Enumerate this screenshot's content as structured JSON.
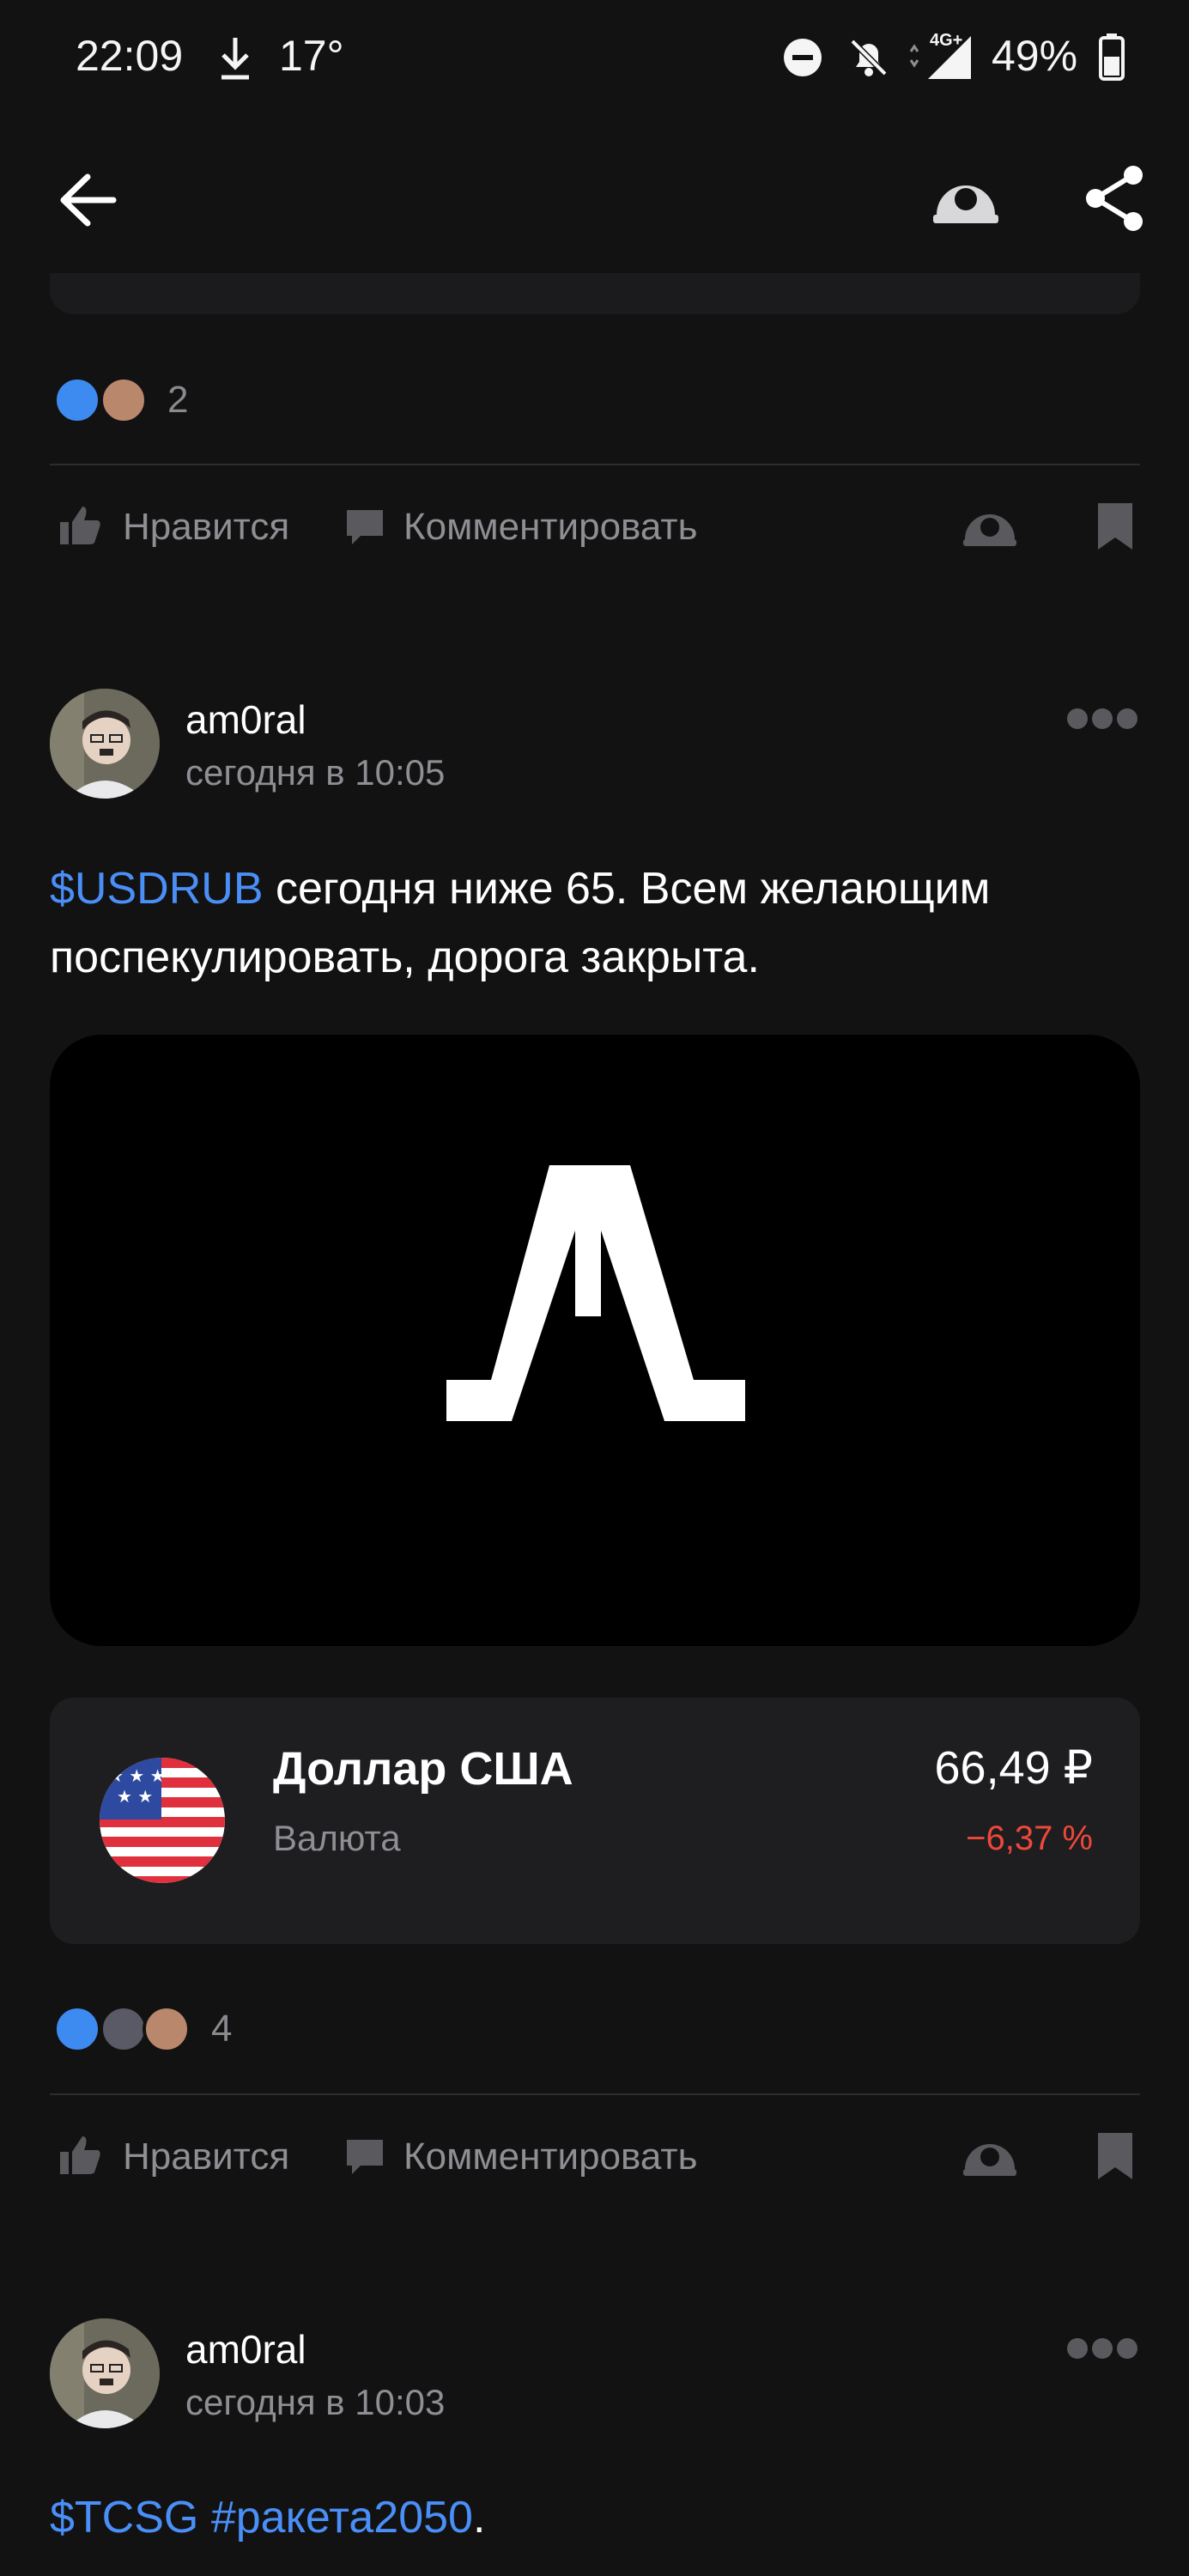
{
  "status_bar": {
    "time": "22:09",
    "temperature": "17°",
    "battery": "49%",
    "network": "4G+"
  },
  "header": {
    "back_icon": "arrow-left-icon",
    "mask_icon": "anonymous-mask-icon",
    "share_icon": "share-icon"
  },
  "post_prev": {
    "reaction_count": "2",
    "actions": {
      "like_label": "Нравится",
      "comment_label": "Комментировать"
    }
  },
  "post1": {
    "author": "am0ral",
    "time": "сегодня в 10:05",
    "text_ticker": "$USDRUB",
    "text_rest": " сегодня ниже 65. Всем желающим поспекулировать, дорога закрыта.",
    "instrument": {
      "name": "Доллар США",
      "type": "Валюта",
      "price": "66,49 ₽",
      "change": "−6,37 %",
      "change_color": "#f0473b",
      "flag_icon": "us-flag-icon"
    },
    "reaction_count": "4",
    "actions": {
      "like_label": "Нравится",
      "comment_label": "Комментировать"
    }
  },
  "post2": {
    "author": "am0ral",
    "time": "сегодня в 10:03",
    "text_ticker": "$TCSG",
    "text_hashtag": "#ракета2050",
    "text_rest": "."
  },
  "colors": {
    "background": "#121213",
    "accent_link": "#4a8ff7",
    "negative": "#f0473b",
    "card": "#1e1e21"
  }
}
